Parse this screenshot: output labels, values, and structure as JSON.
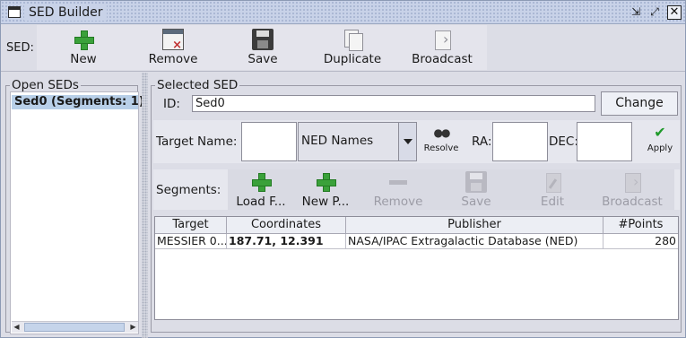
{
  "window": {
    "title": "SED Builder"
  },
  "toolbar": {
    "sed_label": "SED:",
    "buttons": [
      {
        "label": "New",
        "icon": "plus-icon"
      },
      {
        "label": "Remove",
        "icon": "remove-window-icon"
      },
      {
        "label": "Save",
        "icon": "floppy-disk-icon"
      },
      {
        "label": "Duplicate",
        "icon": "duplicate-icon"
      },
      {
        "label": "Broadcast",
        "icon": "broadcast-icon"
      }
    ]
  },
  "open_seds": {
    "title": "Open SEDs",
    "items": [
      "Sed0 (Segments: 1)"
    ],
    "selected_index": 0
  },
  "selected_sed": {
    "title": "Selected SED",
    "id_label": "ID:",
    "id_value": "Sed0",
    "change_label": "Change"
  },
  "target": {
    "name_label": "Target Name:",
    "name_value": "",
    "resolver_selected": "NED Names",
    "resolve_label": "Resolve",
    "ra_label": "RA:",
    "ra_value": "",
    "dec_label": "DEC:",
    "dec_value": "",
    "apply_label": "Apply"
  },
  "segments": {
    "label": "Segments:",
    "buttons": [
      {
        "label": "Load F...",
        "enabled": true
      },
      {
        "label": "New P...",
        "enabled": true
      },
      {
        "label": "Remove",
        "enabled": false
      },
      {
        "label": "Save",
        "enabled": false
      },
      {
        "label": "Edit",
        "enabled": false
      },
      {
        "label": "Broadcast",
        "enabled": false
      }
    ]
  },
  "table": {
    "columns": [
      "Target",
      "Coordinates",
      "Publisher",
      "#Points"
    ],
    "rows": [
      [
        "MESSIER 0...",
        "187.71, 12.391",
        "NASA/IPAC Extragalactic Database (NED)",
        "280"
      ]
    ]
  },
  "colors": {
    "selection": "#b8cfe8",
    "titlebar": "#c8d2e8",
    "accent_green": "#3aa13a"
  }
}
